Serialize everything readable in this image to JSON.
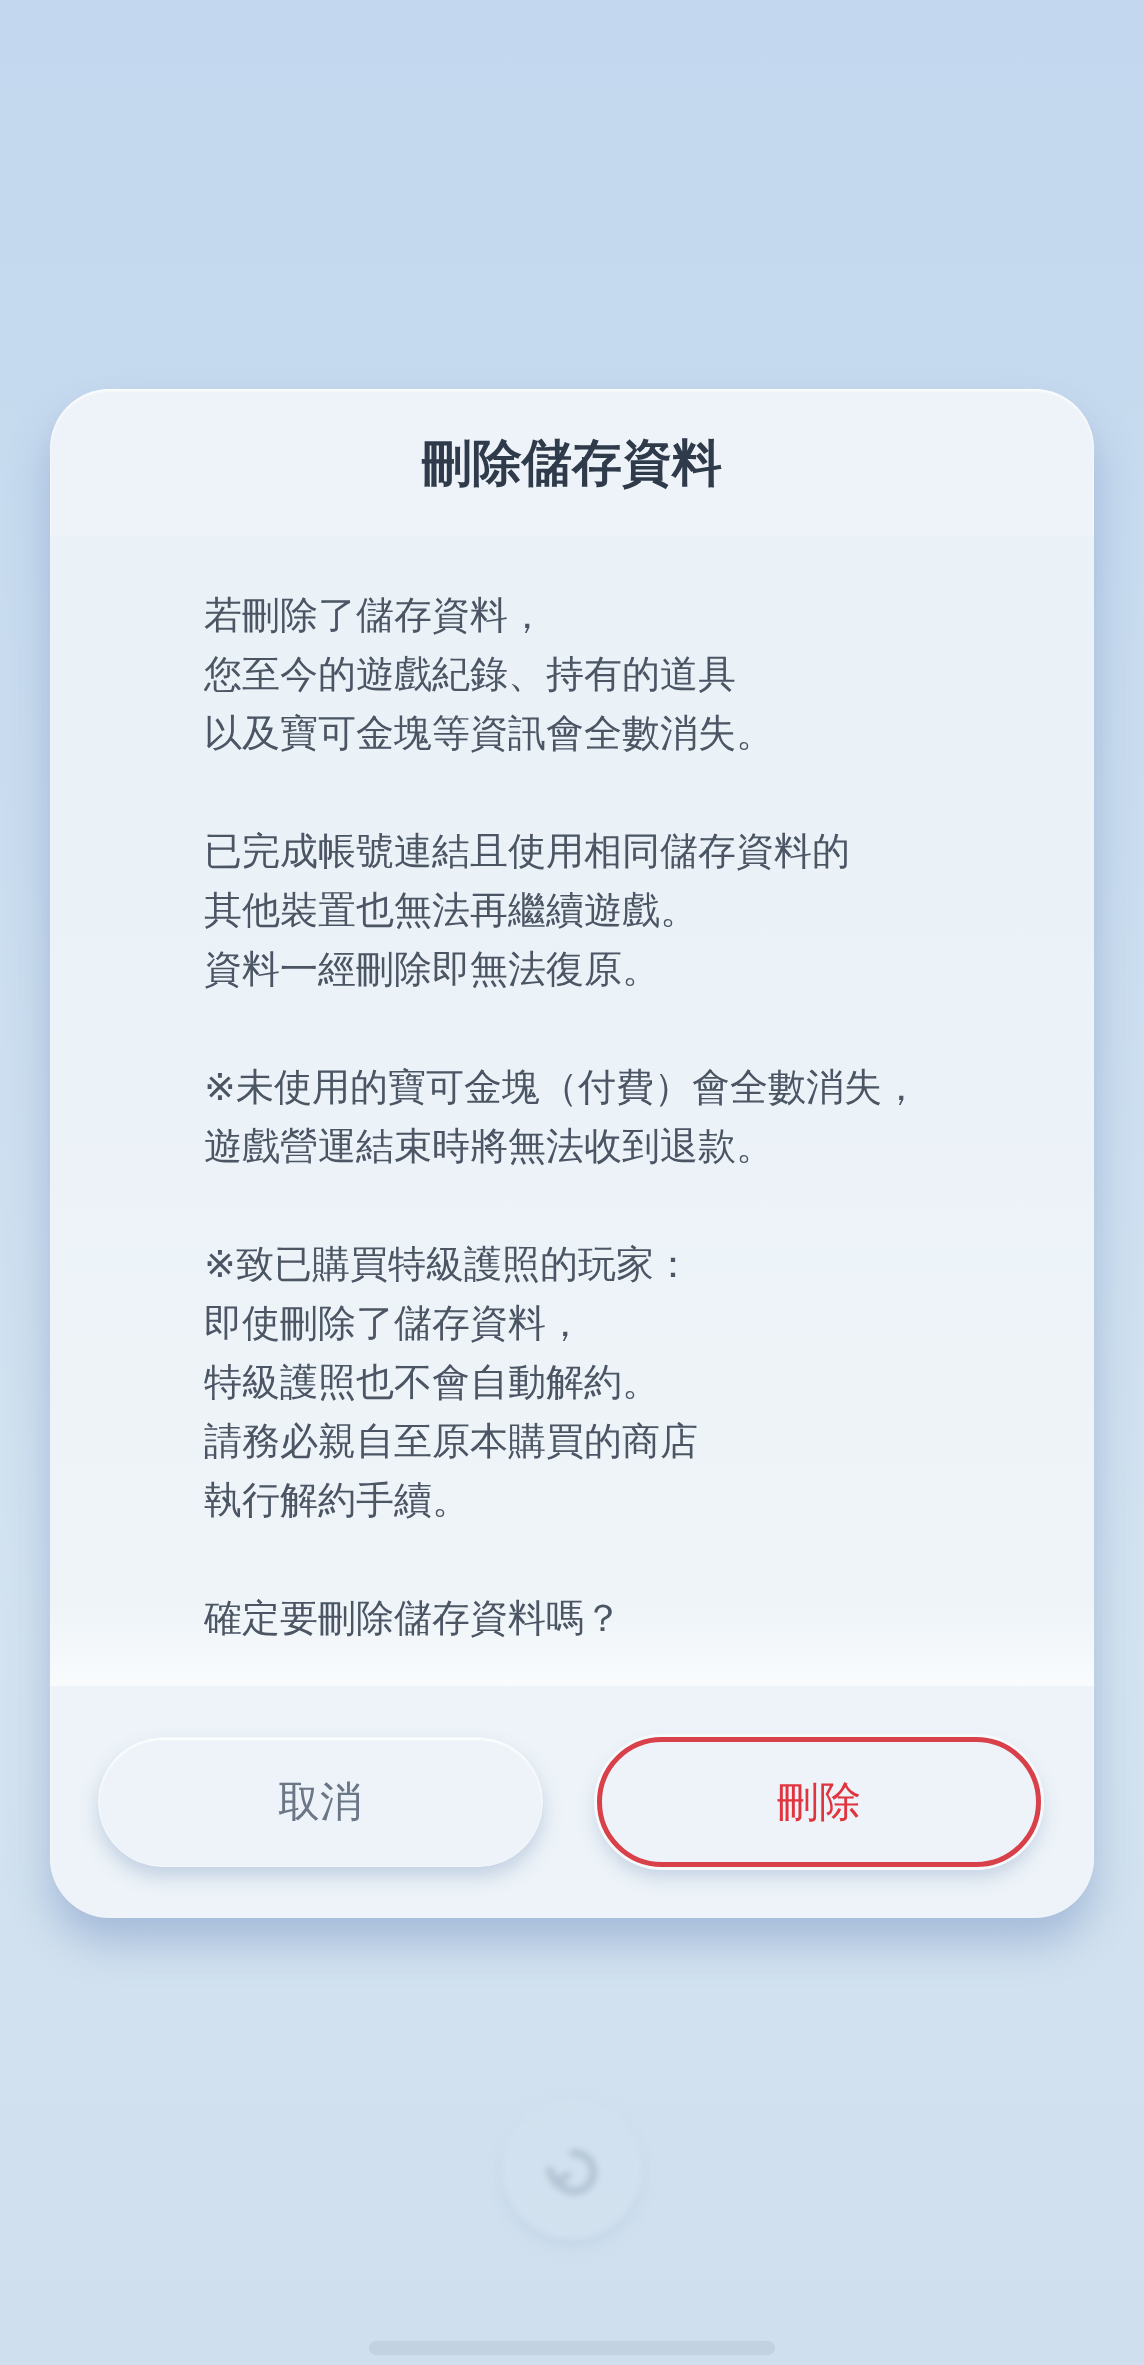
{
  "dialog": {
    "title": "刪除儲存資料",
    "paragraphs": [
      {
        "lines": [
          "若刪除了儲存資料，",
          "您至今的遊戲紀錄、持有的道具",
          "以及寶可金塊等資訊會全數消失。"
        ]
      },
      {
        "lines": [
          "已完成帳號連結且使用相同儲存資料的",
          "其他裝置也無法再繼續遊戲。",
          "資料一經刪除即無法復原。"
        ]
      },
      {
        "lines": [
          "※未使用的寶可金塊（付費）會全數消失，",
          "遊戲營運結束時將無法收到退款。"
        ]
      },
      {
        "lines": [
          "※致已購買特級護照的玩家：",
          "即使刪除了儲存資料，",
          "特級護照也不會自動解約。",
          "請務必親自至原本購買的商店",
          "執行解約手續。"
        ]
      },
      {
        "lines": [
          "確定要刪除儲存資料嗎？"
        ]
      }
    ],
    "buttons": [
      {
        "label": "取消",
        "kind": "secondary"
      },
      {
        "label": "刪除",
        "kind": "danger"
      }
    ]
  }
}
